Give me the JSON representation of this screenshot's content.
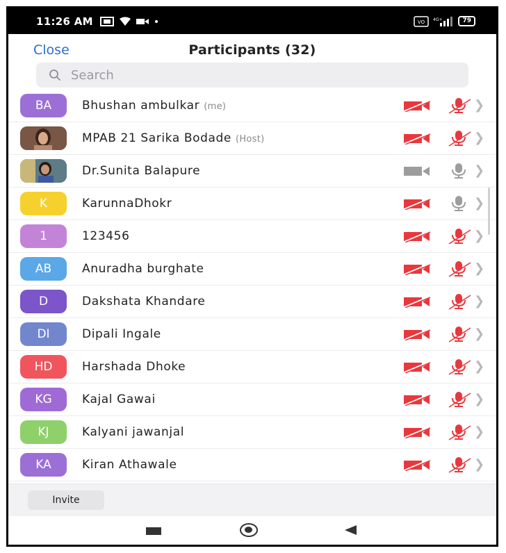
{
  "status_bar": {
    "time": "11:26 AM",
    "battery": "79",
    "icons": [
      "screen-cast-icon",
      "wifi-icon",
      "video-camera-icon",
      "dot-icon",
      "volte-icon",
      "signal-icon",
      "battery-icon"
    ]
  },
  "header": {
    "close_label": "Close",
    "title": "Participants (32)"
  },
  "search": {
    "placeholder": "Search"
  },
  "participants": [
    {
      "initials": "BA",
      "name": "Bhushan ambulkar",
      "role": "(me)",
      "avatar_color": "#9b6fd6",
      "photo": false,
      "video": "off",
      "audio": "muted"
    },
    {
      "initials": "",
      "name": "MPAB 21 Sarika Bodade",
      "role": "(Host)",
      "avatar_color": "#8a6a58",
      "photo": true,
      "video": "off",
      "audio": "muted"
    },
    {
      "initials": "",
      "name": "Dr.Sunita Balapure",
      "role": "",
      "avatar_color": "#6b7f7a",
      "photo": true,
      "video": "gray",
      "audio": "gray"
    },
    {
      "initials": "K",
      "name": "KarunnaDhokr",
      "role": "",
      "avatar_color": "#f6d12e",
      "photo": false,
      "video": "off",
      "audio": "gray"
    },
    {
      "initials": "1",
      "name": "123456",
      "role": "",
      "avatar_color": "#c384d8",
      "photo": false,
      "video": "off",
      "audio": "muted"
    },
    {
      "initials": "AB",
      "name": "Anuradha burghate",
      "role": "",
      "avatar_color": "#5aa8e8",
      "photo": false,
      "video": "off",
      "audio": "muted"
    },
    {
      "initials": "D",
      "name": "Dakshata Khandare",
      "role": "",
      "avatar_color": "#7b55c9",
      "photo": false,
      "video": "off",
      "audio": "muted"
    },
    {
      "initials": "DI",
      "name": "Dipali Ingale",
      "role": "",
      "avatar_color": "#7286cd",
      "photo": false,
      "video": "off",
      "audio": "muted"
    },
    {
      "initials": "HD",
      "name": "Harshada Dhoke",
      "role": "",
      "avatar_color": "#f0555e",
      "photo": false,
      "video": "off",
      "audio": "muted"
    },
    {
      "initials": "KG",
      "name": "Kajal Gawai",
      "role": "",
      "avatar_color": "#a06ad6",
      "photo": false,
      "video": "off",
      "audio": "muted"
    },
    {
      "initials": "KJ",
      "name": "Kalyani jawanjal",
      "role": "",
      "avatar_color": "#8ed06a",
      "photo": false,
      "video": "off",
      "audio": "muted"
    },
    {
      "initials": "KA",
      "name": "Kiran Athawale",
      "role": "",
      "avatar_color": "#9b6fd6",
      "photo": false,
      "video": "off",
      "audio": "muted"
    }
  ],
  "footer": {
    "invite_label": "Invite"
  },
  "colors": {
    "accent": "#2d6cd2",
    "muted_red": "#e8383d",
    "gray_icon": "#9d9d9d"
  }
}
